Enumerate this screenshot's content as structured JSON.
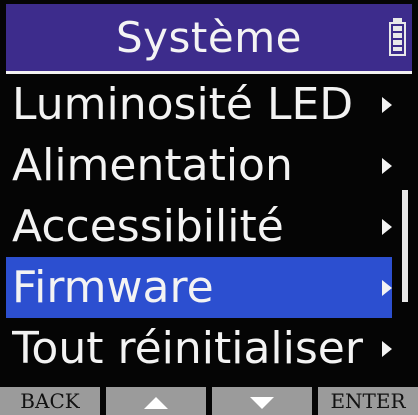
{
  "header": {
    "title": "Système",
    "battery_icon": "battery-full-icon"
  },
  "menu": {
    "items": [
      {
        "label": "Luminosité LED",
        "icon": "chevron-right-icon"
      },
      {
        "label": "Alimentation",
        "icon": "chevron-right-icon"
      },
      {
        "label": "Accessibilité",
        "icon": "chevron-right-icon"
      },
      {
        "label": "Firmware",
        "icon": "chevron-right-icon",
        "selected": true
      },
      {
        "label": "Tout réinitialiser",
        "icon": "chevron-right-icon"
      }
    ]
  },
  "softkeys": {
    "back": "BACK",
    "up_icon": "triangle-up-icon",
    "down_icon": "triangle-down-icon",
    "enter": "ENTER"
  },
  "colors": {
    "header_bg": "#3d2c8c",
    "selected_bg": "#2c4fd0",
    "screen_bg": "#050505",
    "softkey_bg": "#9b9b9b"
  }
}
